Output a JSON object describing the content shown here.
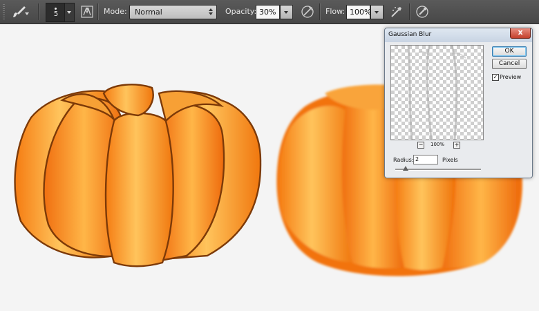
{
  "options_bar": {
    "brush_size": "5",
    "mode_label": "Mode:",
    "mode_value": "Normal",
    "opacity_label": "Opacity:",
    "opacity_value": "30%",
    "flow_label": "Flow:",
    "flow_value": "100%",
    "icons": [
      "brush-tool-icon",
      "toggle-brush-panel-icon",
      "pressure-opacity-icon",
      "airbrush-icon",
      "pressure-size-icon"
    ]
  },
  "dialog": {
    "title": "Gaussian Blur",
    "close_glyph": "x",
    "ok_label": "OK",
    "cancel_label": "Cancel",
    "preview_label": "Preview",
    "preview_checked": true,
    "check_glyph": "✓",
    "zoom_out": "−",
    "zoom_in": "+",
    "zoom_value": "100%",
    "radius_label": "Radius:",
    "radius_value": "2",
    "radius_unit": "Pixels",
    "radius_slider_fraction": 0.12
  },
  "colors": {
    "toolbar_bg": "#4d4d4d",
    "canvas_bg": "#f4f4f4",
    "pumpkin_orange": "#f98a1f",
    "pumpkin_highlight": "#ffc35a",
    "pumpkin_outline": "#8a3d08",
    "dialog_bg": "#e9ebee",
    "close_red": "#c4402c"
  }
}
